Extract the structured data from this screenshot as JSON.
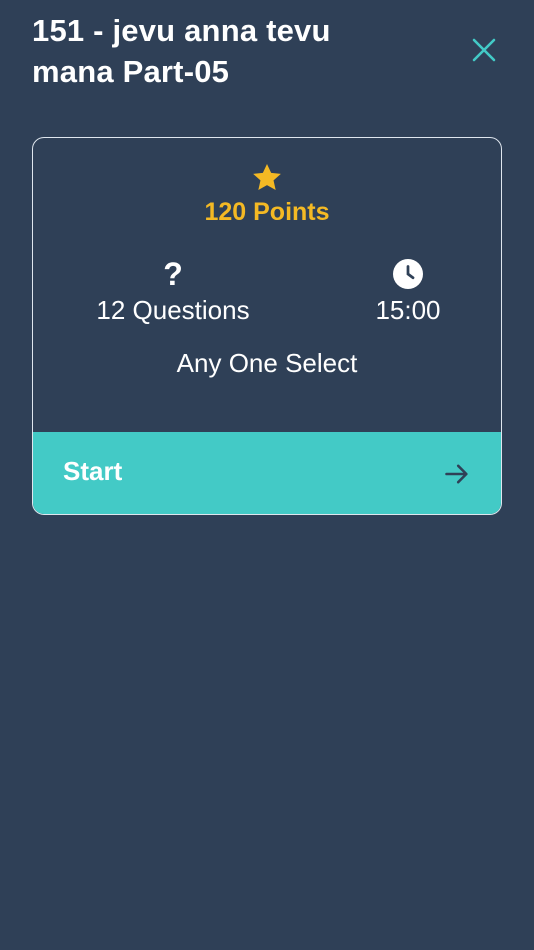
{
  "header": {
    "title": "151 - jevu anna tevu mana Part-05",
    "close_icon": "close-icon"
  },
  "quiz": {
    "points_label": "120 Points",
    "questions_label": "12 Questions",
    "time_label": "15:00",
    "mode_label": "Any One Select",
    "question_mark": "?"
  },
  "start": {
    "label": "Start",
    "icon": "arrow-right-icon"
  },
  "colors": {
    "background": "#2f4057",
    "accent": "#43cac6",
    "points": "#f4b924"
  }
}
